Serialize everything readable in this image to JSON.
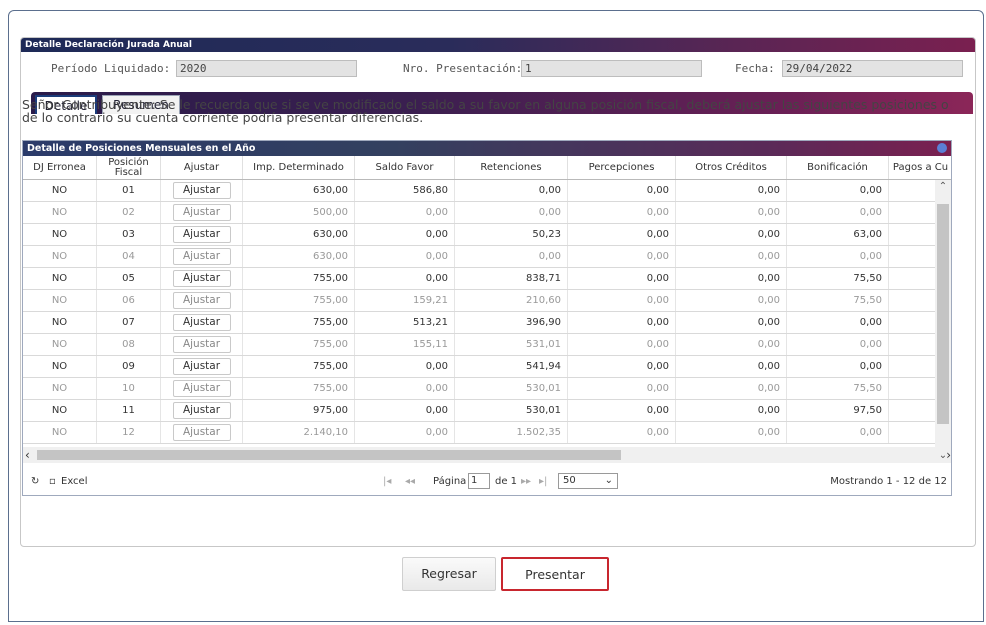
{
  "panel": {
    "title": "Detalle Declaración Jurada Anual"
  },
  "fields": {
    "periodo_label": "Período Liquidado:",
    "periodo_value": "2020",
    "presentacion_label": "Nro. Presentación:",
    "presentacion_value": "1",
    "fecha_label": "Fecha:",
    "fecha_value": "29/04/2022"
  },
  "tabs": [
    {
      "label": "Detalle"
    },
    {
      "label": "Resumen"
    }
  ],
  "notice": "Señor Contribuyente: Se le recuerda que si se ve modificado el saldo a su favor en alguna posición fiscal, deberá ajustar las siguientes posiciones o de lo contrario su cuenta corriente podría presentar diferencias.",
  "grid": {
    "title": "Detalle de Posiciones Mensuales en el Año",
    "columns": [
      "DJ Erronea",
      "Posición Fiscal",
      "Ajustar",
      "Imp. Determinado",
      "Saldo Favor",
      "Retenciones",
      "Percepciones",
      "Otros Créditos",
      "Bonificación",
      "Pagos a Cu"
    ],
    "rows": [
      [
        "NO",
        "01",
        "Ajustar",
        "630,00",
        "586,80",
        "0,00",
        "0,00",
        "0,00",
        "0,00"
      ],
      [
        "NO",
        "02",
        "Ajustar",
        "500,00",
        "0,00",
        "0,00",
        "0,00",
        "0,00",
        "0,00"
      ],
      [
        "NO",
        "03",
        "Ajustar",
        "630,00",
        "0,00",
        "50,23",
        "0,00",
        "0,00",
        "63,00"
      ],
      [
        "NO",
        "04",
        "Ajustar",
        "630,00",
        "0,00",
        "0,00",
        "0,00",
        "0,00",
        "0,00"
      ],
      [
        "NO",
        "05",
        "Ajustar",
        "755,00",
        "0,00",
        "838,71",
        "0,00",
        "0,00",
        "75,50"
      ],
      [
        "NO",
        "06",
        "Ajustar",
        "755,00",
        "159,21",
        "210,60",
        "0,00",
        "0,00",
        "75,50"
      ],
      [
        "NO",
        "07",
        "Ajustar",
        "755,00",
        "513,21",
        "396,90",
        "0,00",
        "0,00",
        "0,00"
      ],
      [
        "NO",
        "08",
        "Ajustar",
        "755,00",
        "155,11",
        "531,01",
        "0,00",
        "0,00",
        "0,00"
      ],
      [
        "NO",
        "09",
        "Ajustar",
        "755,00",
        "0,00",
        "541,94",
        "0,00",
        "0,00",
        "0,00"
      ],
      [
        "NO",
        "10",
        "Ajustar",
        "755,00",
        "0,00",
        "530,01",
        "0,00",
        "0,00",
        "75,50"
      ],
      [
        "NO",
        "11",
        "Ajustar",
        "975,00",
        "0,00",
        "530,01",
        "0,00",
        "0,00",
        "97,50"
      ],
      [
        "NO",
        "12",
        "Ajustar",
        "2.140,10",
        "0,00",
        "1.502,35",
        "0,00",
        "0,00",
        "0,00"
      ]
    ]
  },
  "pager": {
    "excel_label": "Excel",
    "page_label": "Página",
    "page_value": "1",
    "of_label": "de 1",
    "page_size": "50",
    "showing": "Mostrando 1 - 12 de 12"
  },
  "buttons": {
    "regresar": "Regresar",
    "presentar": "Presentar"
  },
  "colors": {
    "header_gradient_start": "#1e2a57",
    "header_gradient_end": "#7a2050",
    "highlight_border": "#c8262e"
  }
}
